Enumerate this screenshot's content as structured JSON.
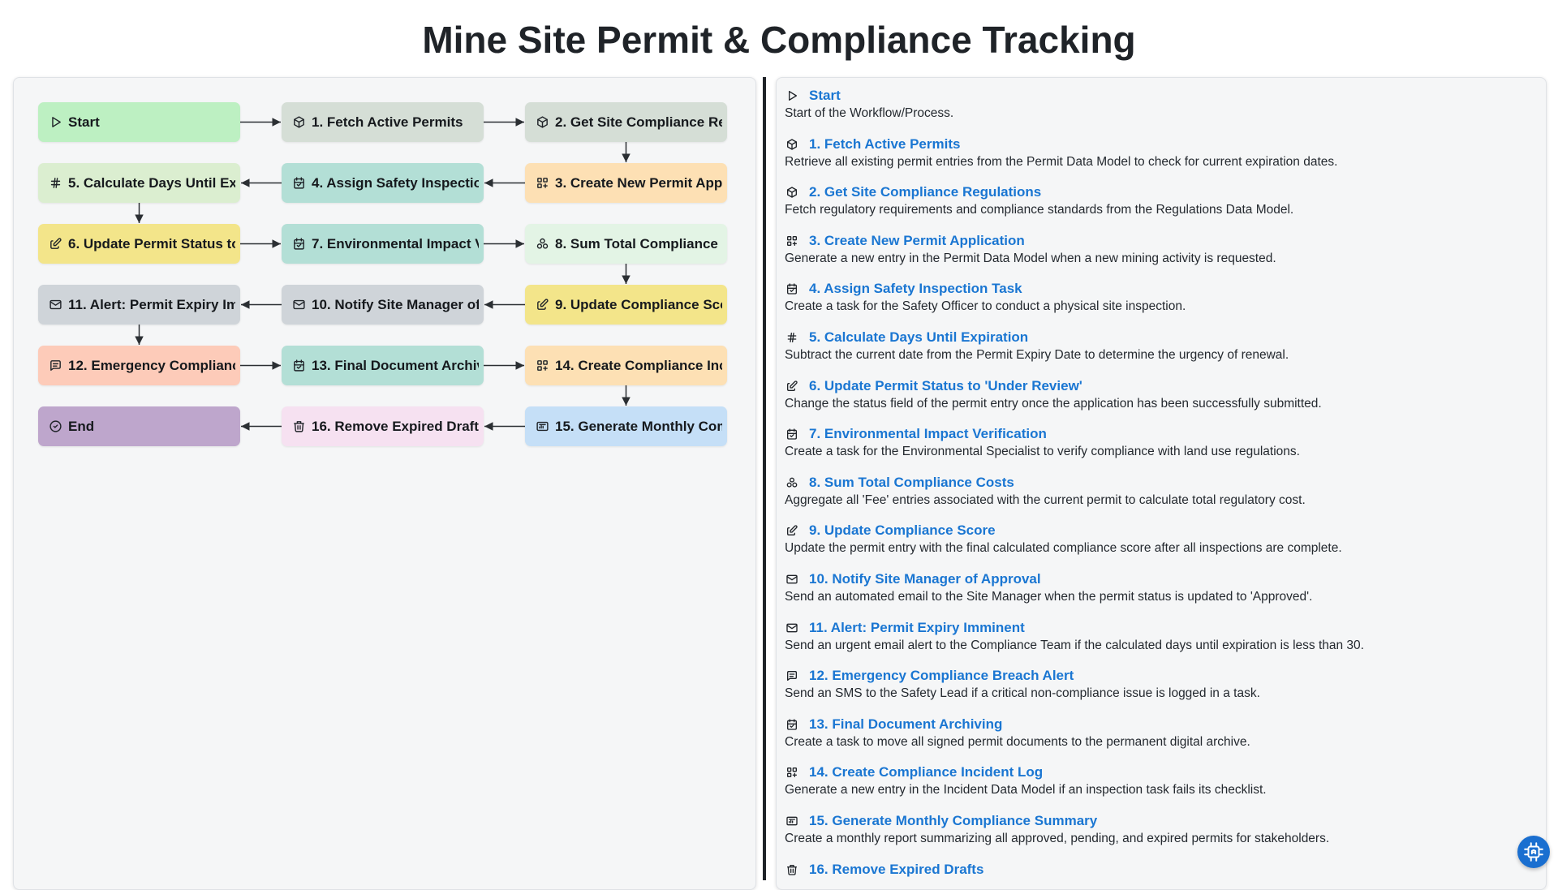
{
  "title": "Mine Site Permit & Compliance Tracking",
  "colors": {
    "link": "#1a76d2",
    "green": "#bdf0c2",
    "sage": "#d5ded6",
    "peach": "#fde0b4",
    "teal": "#b3dfd6",
    "lime": "#dbeed0",
    "yellow": "#f3e58a",
    "mint": "#e3f4e5",
    "gray": "#cfd4d9",
    "salmon": "#fdcbb9",
    "blue": "#c5dff7",
    "pink": "#f6e1f1",
    "purple": "#bea6cc"
  },
  "steps": [
    {
      "label": "Start",
      "icon": "play-icon",
      "color": "green",
      "description": "Start of the Workflow/Process."
    },
    {
      "label": "1. Fetch Active Permits",
      "icon": "cube-icon",
      "color": "sage",
      "description": "Retrieve all existing permit entries from the Permit Data Model to check for current expiration dates."
    },
    {
      "label": "2. Get Site Compliance Regulations",
      "icon": "cube-icon",
      "color": "sage",
      "description": "Fetch regulatory requirements and compliance standards from the Regulations Data Model."
    },
    {
      "label": "3. Create New Permit Application",
      "icon": "grid-plus-icon",
      "color": "peach",
      "description": "Generate a new entry in the Permit Data Model when a new mining activity is requested."
    },
    {
      "label": "4. Assign Safety Inspection Task",
      "icon": "calendar-check-icon",
      "color": "teal",
      "description": "Create a task for the Safety Officer to conduct a physical site inspection."
    },
    {
      "label": "5. Calculate Days Until Expiration",
      "icon": "hash-icon",
      "color": "lime",
      "description": "Subtract the current date from the Permit Expiry Date to determine the urgency of renewal."
    },
    {
      "label": "6. Update Permit Status to 'Under Review'",
      "icon": "edit-icon",
      "color": "yellow",
      "description": "Change the status field of the permit entry once the application has been successfully submitted."
    },
    {
      "label": "7. Environmental Impact Verification",
      "icon": "calendar-check-icon",
      "color": "teal",
      "description": "Create a task for the Environmental Specialist to verify compliance with land use regulations."
    },
    {
      "label": "8. Sum Total Compliance Costs",
      "icon": "circles-icon",
      "color": "mint",
      "description": "Aggregate all 'Fee' entries associated with the current permit to calculate total regulatory cost."
    },
    {
      "label": "9. Update Compliance Score",
      "icon": "edit-icon",
      "color": "yellow",
      "description": "Update the permit entry with the final calculated compliance score after all inspections are complete."
    },
    {
      "label": "10. Notify Site Manager of Approval",
      "icon": "mail-icon",
      "color": "gray",
      "description": "Send an automated email to the Site Manager when the permit status is updated to 'Approved'."
    },
    {
      "label": "11. Alert: Permit Expiry Imminent",
      "icon": "mail-icon",
      "color": "gray",
      "description": "Send an urgent email alert to the Compliance Team if the calculated days until expiration is less than 30."
    },
    {
      "label": "12. Emergency Compliance Breach Alert",
      "icon": "message-icon",
      "color": "salmon",
      "description": "Send an SMS to the Safety Lead if a critical non-compliance issue is logged in a task."
    },
    {
      "label": "13. Final Document Archiving",
      "icon": "calendar-check-icon",
      "color": "teal",
      "description": "Create a task to move all signed permit documents to the permanent digital archive."
    },
    {
      "label": "14. Create Compliance Incident Log",
      "icon": "grid-plus-icon",
      "color": "peach",
      "description": "Generate a new entry in the Incident Data Model if an inspection task fails its checklist."
    },
    {
      "label": "15. Generate Monthly Compliance Summary",
      "icon": "report-icon",
      "color": "blue",
      "description": "Create a monthly report summarizing all approved, pending, and expired permits for stakeholders."
    },
    {
      "label": "16. Remove Expired Drafts",
      "icon": "trash-icon",
      "color": "pink",
      "description": ""
    },
    {
      "label": "End",
      "icon": "check-circle-icon",
      "color": "purple",
      "description": ""
    }
  ]
}
